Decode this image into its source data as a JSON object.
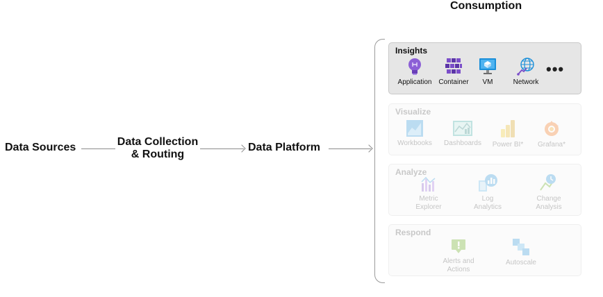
{
  "diagram": {
    "title": "Consumption",
    "flow": [
      {
        "label": "Data Sources"
      },
      {
        "label_line1": "Data Collection",
        "label_line2": "& Routing"
      },
      {
        "label": "Data Platform"
      }
    ],
    "panels": {
      "insights": {
        "title": "Insights",
        "items": [
          {
            "label": "Application",
            "icon": "lightbulb-icon"
          },
          {
            "label": "Container",
            "icon": "container-cubes-icon"
          },
          {
            "label": "VM",
            "icon": "monitor-icon"
          },
          {
            "label": "Network",
            "icon": "globe-network-icon"
          }
        ],
        "more": "•••"
      },
      "visualize": {
        "title": "Visualize",
        "items": [
          {
            "label": "Workbooks",
            "icon": "workbook-chart-icon"
          },
          {
            "label": "Dashboards",
            "icon": "dashboard-chart-icon"
          },
          {
            "label": "Power BI*",
            "icon": "powerbi-icon"
          },
          {
            "label": "Grafana*",
            "icon": "grafana-icon"
          }
        ]
      },
      "analyze": {
        "title": "Analyze",
        "items": [
          {
            "label_line1": "Metric",
            "label_line2": "Explorer",
            "icon": "metric-explorer-icon"
          },
          {
            "label_line1": "Log",
            "label_line2": "Analytics",
            "icon": "log-analytics-icon"
          },
          {
            "label_line1": "Change",
            "label_line2": "Analysis",
            "icon": "change-analysis-icon"
          }
        ]
      },
      "respond": {
        "title": "Respond",
        "items": [
          {
            "label_line1": "Alerts and",
            "label_line2": "Actions",
            "icon": "alert-icon"
          },
          {
            "label": "Autoscale",
            "icon": "autoscale-icon"
          }
        ]
      }
    },
    "colors": {
      "insights_bg": "#e6e6e6",
      "arrow": "#8a8a8a",
      "purple": "#7b4ec9",
      "blue": "#1a8fd9"
    }
  }
}
